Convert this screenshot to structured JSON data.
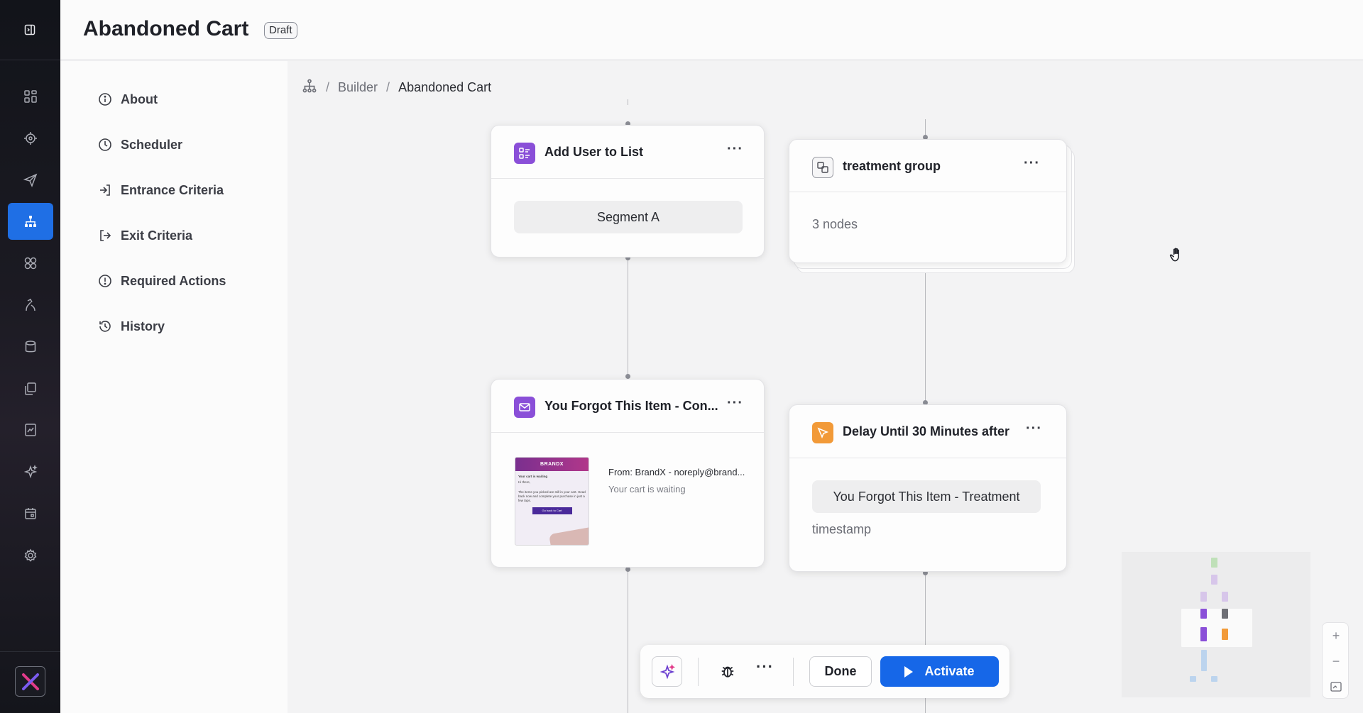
{
  "header": {
    "title": "Abandoned Cart",
    "status": "Draft"
  },
  "submenu": {
    "items": [
      {
        "label": "About",
        "icon": "info-icon"
      },
      {
        "label": "Scheduler",
        "icon": "clock-icon"
      },
      {
        "label": "Entrance Criteria",
        "icon": "enter-icon"
      },
      {
        "label": "Exit Criteria",
        "icon": "exit-icon"
      },
      {
        "label": "Required Actions",
        "icon": "alert-icon"
      },
      {
        "label": "History",
        "icon": "history-icon"
      }
    ]
  },
  "breadcrumb": {
    "root": "Builder",
    "current": "Abandoned Cart"
  },
  "nodes": {
    "add_user": {
      "title": "Add User to List",
      "value": "Segment A",
      "icon": "list-icon",
      "color": "#8a4fd8"
    },
    "treatment": {
      "title": "treatment group",
      "count": "3 nodes",
      "icon": "group-icon"
    },
    "email": {
      "title": "You Forgot This Item - Con...",
      "from": "From: BrandX - noreply@brand...",
      "subject": "Your cart is waiting",
      "icon": "mail-icon",
      "color": "#8a4fd8",
      "preview": {
        "brand": "BRANDX",
        "heading": "Your cart is waiting",
        "line": "Hi there,",
        "body": "The items you picked are still in your cart. Head back now and complete your purchase in just a few taps.",
        "cta": "Go back to Cart"
      }
    },
    "delay": {
      "title": "Delay Until 30 Minutes after",
      "value": "You Forgot This Item - Treatment",
      "field": "timestamp",
      "icon": "cursor-icon",
      "color": "#f29a38"
    }
  },
  "toolbar": {
    "done_label": "Done",
    "activate_label": "Activate"
  },
  "colors": {
    "accent": "#1667e8",
    "active_nav": "#1f6fe5",
    "purple": "#8a4fd8",
    "orange": "#f29a38"
  }
}
